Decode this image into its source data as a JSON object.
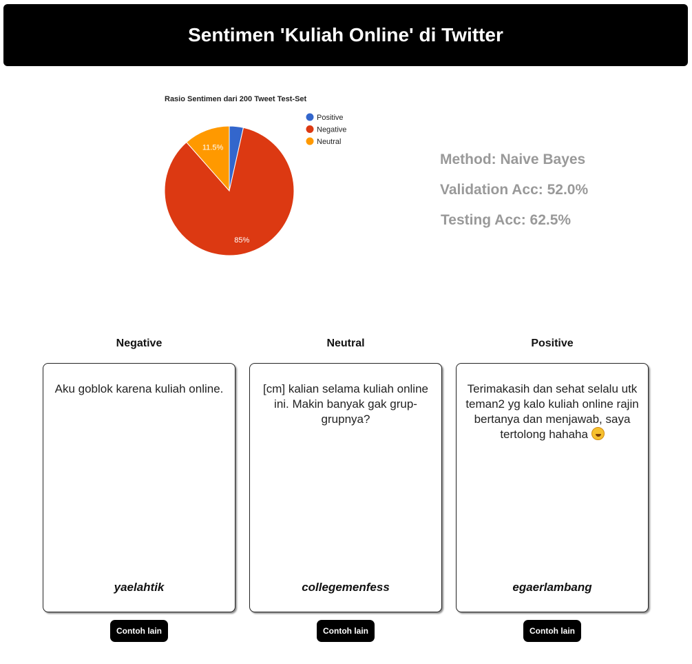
{
  "header": {
    "title": "Sentimen 'Kuliah Online' di Twitter"
  },
  "chart_data": {
    "type": "pie",
    "title": "Rasio Sentimen dari 200 Tweet Test-Set",
    "categories": [
      "Positive",
      "Negative",
      "Neutral"
    ],
    "values": [
      3.5,
      85,
      11.5
    ],
    "data_labels": [
      "",
      "85%",
      "11.5%"
    ],
    "colors": [
      "#3366cc",
      "#dc3912",
      "#ff9900"
    ],
    "legend": "right"
  },
  "stats": {
    "method": "Method: Naive Bayes",
    "validation": "Validation Acc: 52.0%",
    "testing": "Testing Acc: 62.5%"
  },
  "columns": [
    {
      "title": "Negative",
      "text": "Aku goblok karena kuliah online.",
      "author": "yaelahtik",
      "button": "Contoh lain"
    },
    {
      "title": "Neutral",
      "text": "[cm] kalian selama kuliah online ini. Makin banyak gak grup-grupnya?",
      "author": "collegemenfess",
      "button": "Contoh lain"
    },
    {
      "title": "Positive",
      "text": "Terimakasih dan sehat selalu utk teman2 yg kalo kuliah online rajin bertanya dan menjawab, saya tertolong hahaha",
      "emoji": "rolling-on-floor-laughing-emoji",
      "author": "egaerlambang",
      "button": "Contoh lain"
    }
  ]
}
